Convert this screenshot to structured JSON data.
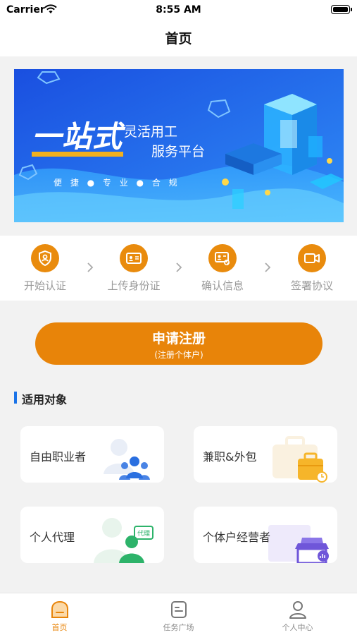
{
  "status_bar": {
    "carrier": "Carrier",
    "time": "8:55 AM"
  },
  "nav": {
    "title": "首页"
  },
  "banner": {
    "headline": "一站式",
    "line1": "灵活用工",
    "line2": "服务平台",
    "tags": "便 捷 ● 专 业 ● 合 规"
  },
  "steps": [
    {
      "label": "开始认证",
      "icon": "shield-user-icon"
    },
    {
      "label": "上传身份证",
      "icon": "id-card-icon"
    },
    {
      "label": "确认信息",
      "icon": "id-check-icon"
    },
    {
      "label": "签署协议",
      "icon": "video-icon"
    }
  ],
  "register": {
    "title": "申请注册",
    "subtitle": "(注册个体户)"
  },
  "section": {
    "title": "适用对象"
  },
  "cards": [
    {
      "label": "自由职业者",
      "icon": "group-people-icon"
    },
    {
      "label": "兼职&外包",
      "icon": "briefcase-icon"
    },
    {
      "label": "个人代理",
      "icon": "agent-icon"
    },
    {
      "label": "个体户经营者",
      "icon": "shop-icon"
    }
  ],
  "tabs": [
    {
      "label": "首页",
      "icon": "home-icon",
      "active": true
    },
    {
      "label": "任务广场",
      "icon": "task-icon",
      "active": false
    },
    {
      "label": "个人中心",
      "icon": "user-icon",
      "active": false
    }
  ],
  "colors": {
    "accent": "#e88409",
    "section_bar": "#1a73e8",
    "banner_blue": "#1e6ef0"
  }
}
